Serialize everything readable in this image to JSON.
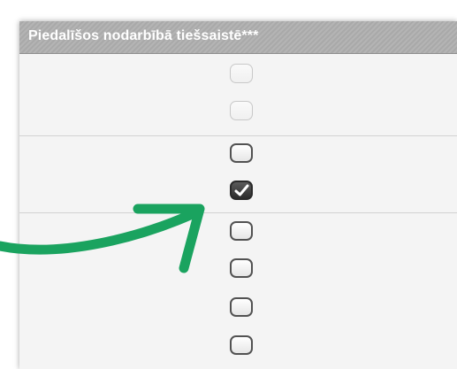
{
  "panel": {
    "header": {
      "title": "Piedalīšos nodarbībā tiešsaistē***"
    },
    "checkboxes": [
      {
        "state": "unchecked",
        "enabled": false
      },
      {
        "state": "unchecked",
        "enabled": false
      },
      {
        "state": "unchecked",
        "enabled": true
      },
      {
        "state": "checked",
        "enabled": true
      },
      {
        "state": "unchecked",
        "enabled": true
      },
      {
        "state": "unchecked",
        "enabled": true
      },
      {
        "state": "unchecked",
        "enabled": true
      },
      {
        "state": "unchecked",
        "enabled": true
      }
    ]
  },
  "annotation": {
    "arrow_icon": "curved-arrow-icon",
    "arrow_color": "#1aa35f"
  },
  "colors": {
    "header_bg": "#b0b0b0",
    "panel_bg": "#f4f4f4",
    "checkbox_border": "#525252"
  }
}
